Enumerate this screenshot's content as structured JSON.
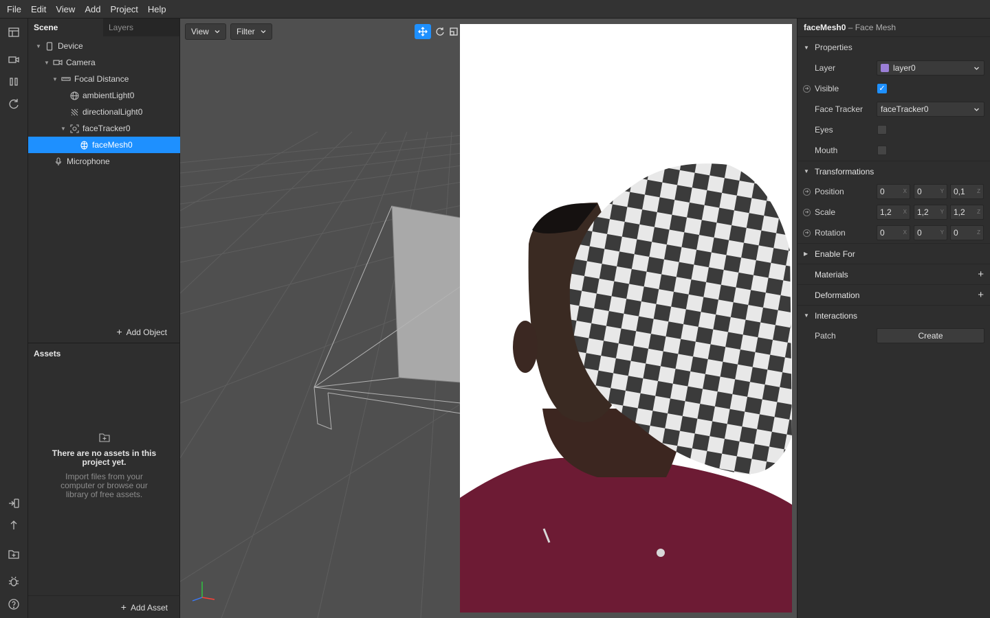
{
  "menu": [
    "File",
    "Edit",
    "View",
    "Add",
    "Project",
    "Help"
  ],
  "left_tabs": {
    "scene": "Scene",
    "layers": "Layers"
  },
  "tree": [
    {
      "label": "Device",
      "icon": "device-icon",
      "depth": 0,
      "expanded": true
    },
    {
      "label": "Camera",
      "icon": "camera-icon",
      "depth": 1,
      "expanded": true
    },
    {
      "label": "Focal Distance",
      "icon": "focal-distance-icon",
      "depth": 2,
      "expanded": true
    },
    {
      "label": "ambientLight0",
      "icon": "ambient-light-icon",
      "depth": 3
    },
    {
      "label": "directionalLight0",
      "icon": "directional-light-icon",
      "depth": 3
    },
    {
      "label": "faceTracker0",
      "icon": "face-tracker-icon",
      "depth": 3,
      "expanded": true
    },
    {
      "label": "faceMesh0",
      "icon": "face-mesh-icon",
      "depth": 4,
      "selected": true
    },
    {
      "label": "Microphone",
      "icon": "microphone-icon",
      "depth": 1
    }
  ],
  "add_object": "Add Object",
  "assets": {
    "title": "Assets",
    "empty_title": "There are no assets in this project yet.",
    "empty_body": "Import files from your computer or browse our library of free assets.",
    "add_asset": "Add Asset"
  },
  "viewport": {
    "view_label": "View",
    "filter_label": "Filter"
  },
  "inspector": {
    "object_name": "faceMesh0",
    "object_type": "– Face Mesh",
    "sections": {
      "properties": "Properties",
      "transformations": "Transformations",
      "enable_for": "Enable For",
      "materials": "Materials",
      "deformation": "Deformation",
      "interactions": "Interactions"
    },
    "layer": {
      "label": "Layer",
      "value": "layer0",
      "color": "#9b7fd6"
    },
    "visible": {
      "label": "Visible",
      "checked": true
    },
    "face_tracker": {
      "label": "Face Tracker",
      "value": "faceTracker0"
    },
    "eyes": {
      "label": "Eyes",
      "checked": false
    },
    "mouth": {
      "label": "Mouth",
      "checked": false
    },
    "position": {
      "label": "Position",
      "x": "0",
      "y": "0",
      "z": "0,1"
    },
    "scale": {
      "label": "Scale",
      "x": "1,2",
      "y": "1,2",
      "z": "1,2"
    },
    "rotation": {
      "label": "Rotation",
      "x": "0",
      "y": "0",
      "z": "0"
    },
    "axes": {
      "x": "X",
      "y": "Y",
      "z": "Z"
    },
    "patch": {
      "label": "Patch",
      "button": "Create"
    }
  },
  "colors": {
    "accent": "#1e90ff"
  }
}
